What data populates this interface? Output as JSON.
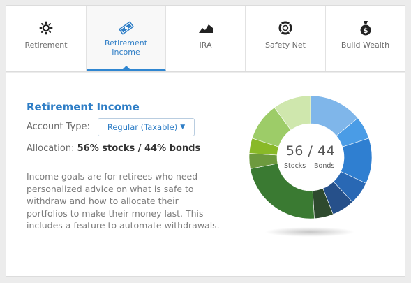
{
  "tabs": [
    {
      "label": "Retirement",
      "icon": "sun-icon",
      "active": false
    },
    {
      "label": "Retirement Income",
      "icon": "money-icon",
      "active": true
    },
    {
      "label": "IRA",
      "icon": "chart-icon",
      "active": false
    },
    {
      "label": "Safety Net",
      "icon": "lifebuoy-icon",
      "active": false
    },
    {
      "label": "Build Wealth",
      "icon": "money-bag-icon",
      "active": false
    }
  ],
  "panel": {
    "title": "Retirement Income",
    "account_type_label": "Account Type:",
    "account_type_value": "Regular (Taxable)",
    "allocation_label": "Allocation:",
    "allocation_value": "56% stocks / 44% bonds",
    "description": "Income goals are for retirees who need personalized advice on what is safe to withdraw and how to allocate their portfolios to make their money last. This includes a feature to automate withdrawals."
  },
  "donut": {
    "center_value": "56 / 44",
    "stocks_label": "Stocks",
    "bonds_label": "Bonds"
  },
  "chart_data": {
    "type": "pie",
    "title": "",
    "categories": [
      "Bonds",
      "Stocks"
    ],
    "values": [
      44,
      56
    ],
    "segments": [
      {
        "group": "Bonds",
        "value": 14,
        "color": "#7fb6ea"
      },
      {
        "group": "Bonds",
        "value": 6,
        "color": "#4a9ce6"
      },
      {
        "group": "Bonds",
        "value": 12,
        "color": "#2f7fd1"
      },
      {
        "group": "Bonds",
        "value": 6,
        "color": "#2968b4"
      },
      {
        "group": "Bonds",
        "value": 6,
        "color": "#26508a"
      },
      {
        "group": "Stocks",
        "value": 5,
        "color": "#2e4a2e"
      },
      {
        "group": "Stocks",
        "value": 23,
        "color": "#3a7a32"
      },
      {
        "group": "Stocks",
        "value": 4,
        "color": "#6d9a3e"
      },
      {
        "group": "Stocks",
        "value": 4,
        "color": "#89b928"
      },
      {
        "group": "Stocks",
        "value": 10,
        "color": "#9dcc68"
      },
      {
        "group": "Stocks",
        "value": 10,
        "color": "#cfe7ad"
      }
    ]
  },
  "colors": {
    "accent": "#2f7ec6",
    "tab_underline": "#2f86d1"
  }
}
